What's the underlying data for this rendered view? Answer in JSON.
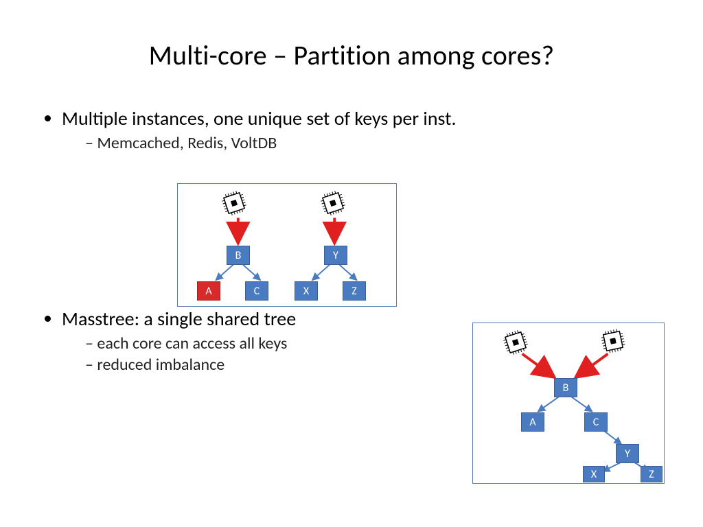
{
  "title": "Multi-core – Partition among cores?",
  "b1": "Multiple instances, one unique set of keys per inst.",
  "b1s1": "Memcached, Redis, VoltDB",
  "b2": "Masstree: a single shared tree",
  "b2s1": "each core can access all keys",
  "b2s2": "reduced imbalance",
  "nodes1": {
    "B": "B",
    "A": "A",
    "C": "C",
    "Y": "Y",
    "X": "X",
    "Z": "Z"
  },
  "nodes2": {
    "B": "B",
    "A": "A",
    "C": "C",
    "Y": "Y",
    "X": "X",
    "Z": "Z"
  }
}
